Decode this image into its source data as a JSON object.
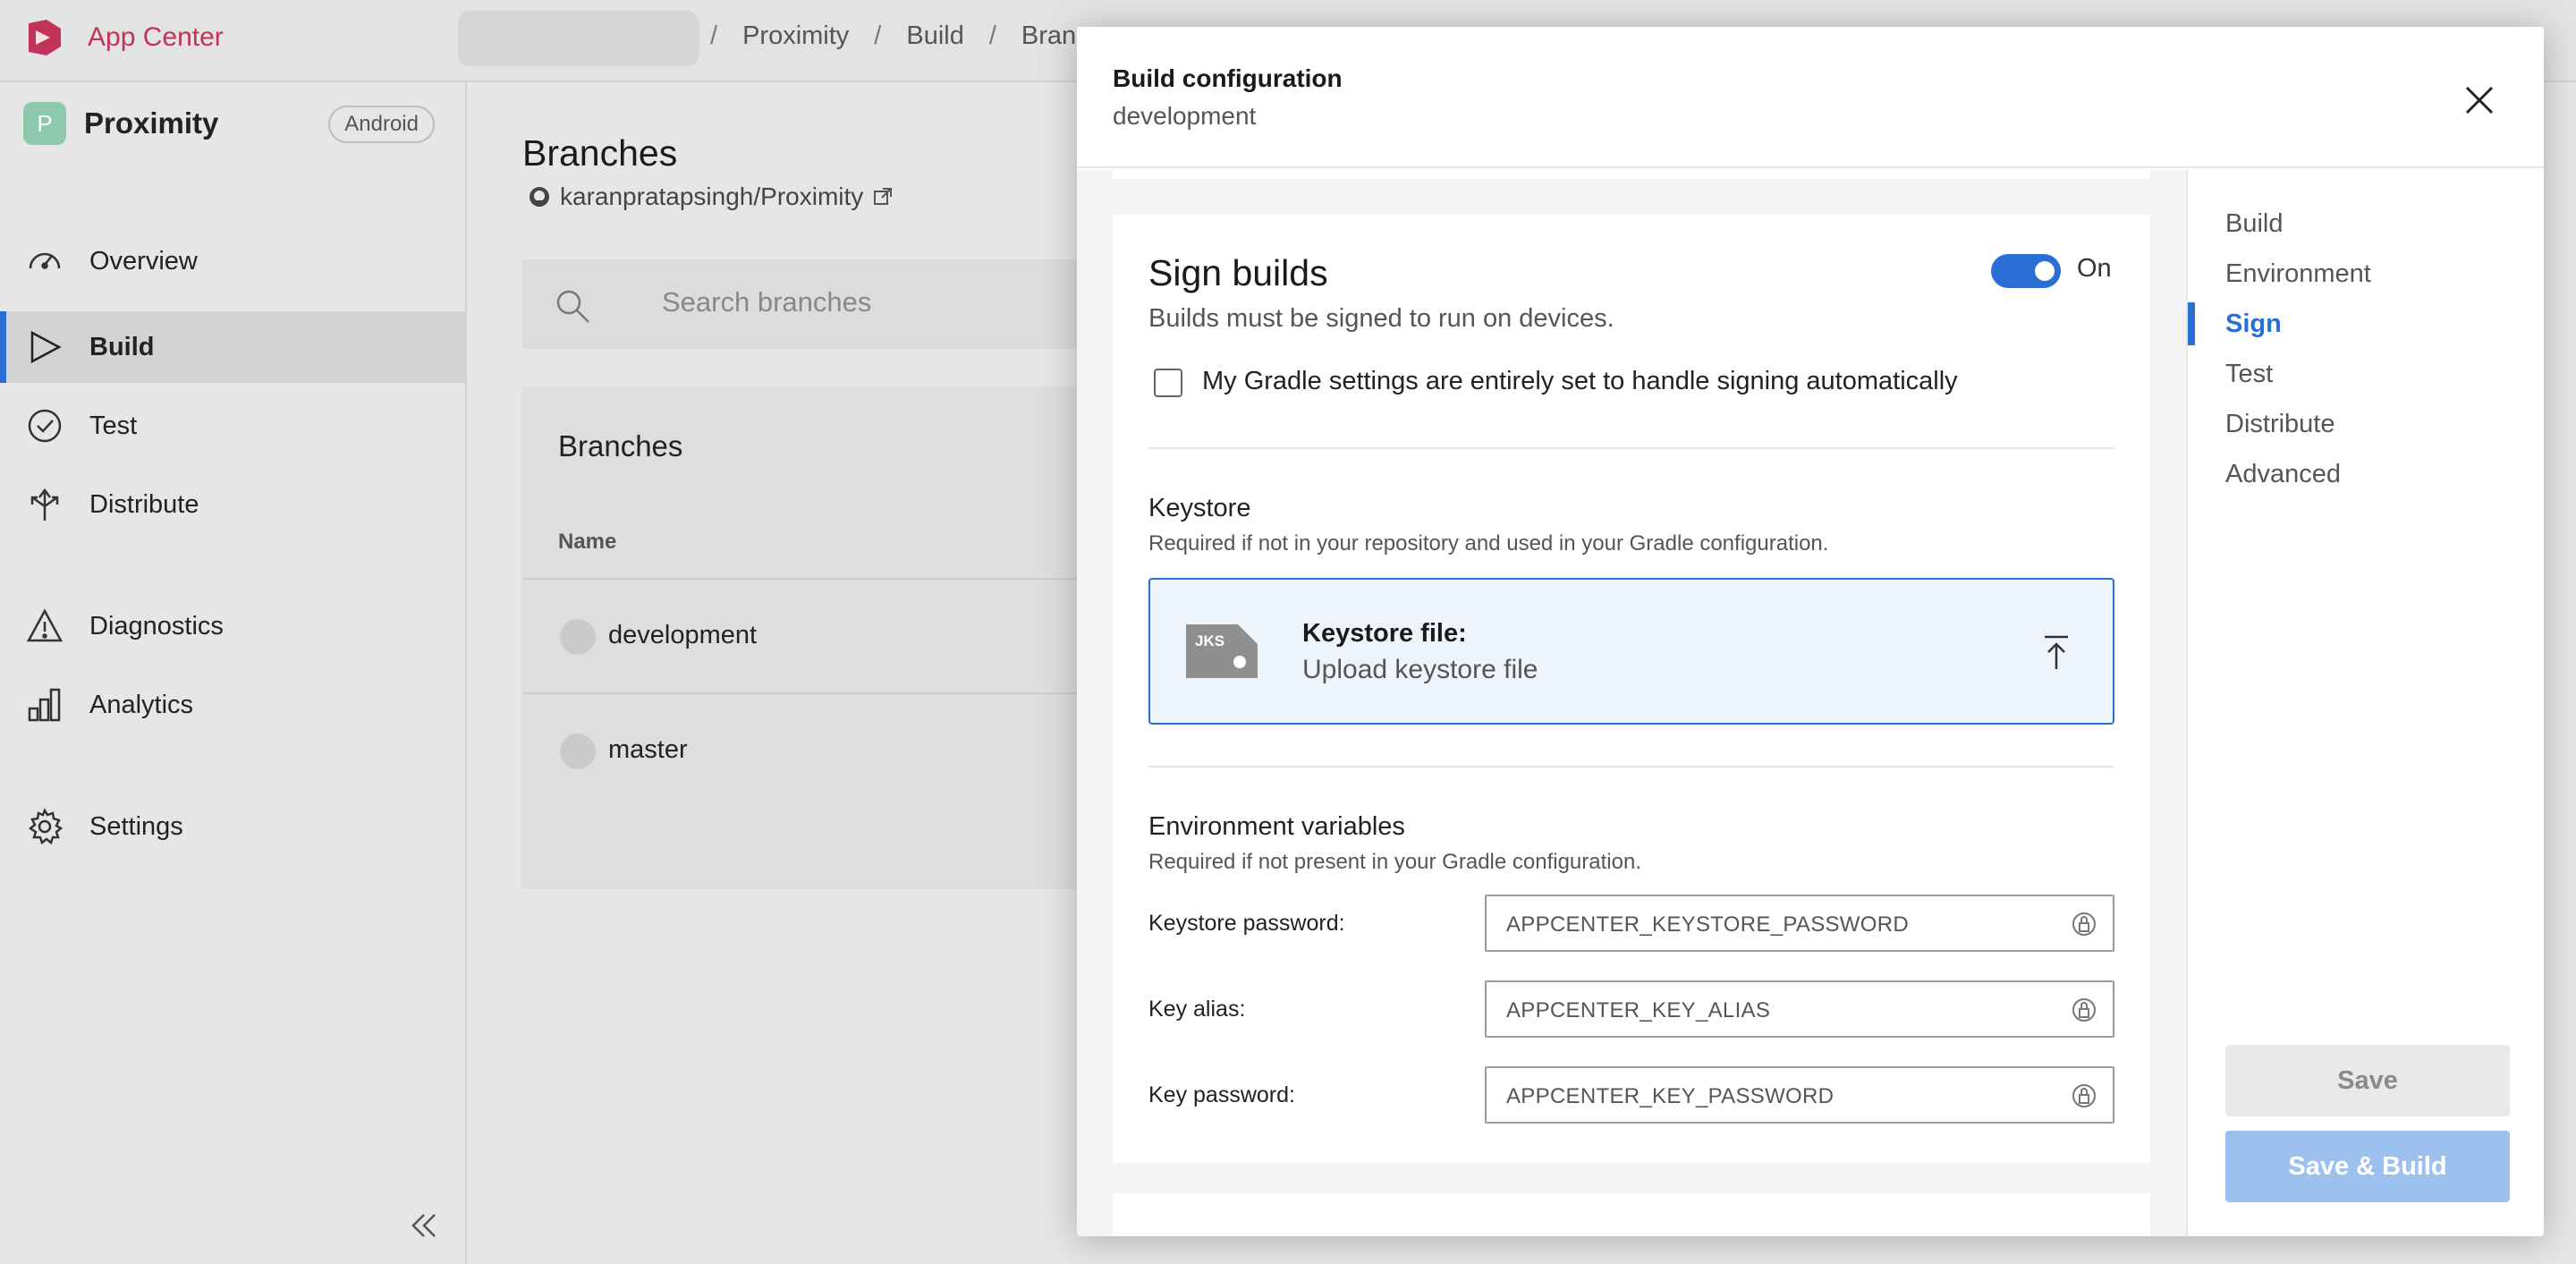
{
  "topbar": {
    "brand": "App Center",
    "breadcrumb": [
      "Proximity",
      "Build",
      "Bran"
    ]
  },
  "sidebar": {
    "app_initial": "P",
    "app_name": "Proximity",
    "os_badge": "Android",
    "items": [
      {
        "label": "Overview",
        "icon": "gauge-icon"
      },
      {
        "label": "Build",
        "icon": "play-icon",
        "active": true
      },
      {
        "label": "Test",
        "icon": "check-circle-icon"
      },
      {
        "label": "Distribute",
        "icon": "distribute-icon"
      },
      {
        "label": "Diagnostics",
        "icon": "warning-icon"
      },
      {
        "label": "Analytics",
        "icon": "bar-chart-icon"
      },
      {
        "label": "Settings",
        "icon": "gear-icon"
      }
    ]
  },
  "main": {
    "title": "Branches",
    "repo": "karanpratapsingh/Proximity",
    "search_placeholder": "Search branches",
    "card_title": "Branches",
    "column_name": "Name",
    "rows": [
      {
        "name": "development"
      },
      {
        "name": "master"
      }
    ]
  },
  "modal": {
    "title": "Build configuration",
    "subtitle": "development",
    "sign": {
      "title": "Sign builds",
      "description": "Builds must be signed to run on devices.",
      "toggle_label": "On",
      "toggle_on": true,
      "checkbox_label": "My Gradle settings are entirely set to handle signing automatically",
      "checkbox_checked": false,
      "keystore_title": "Keystore",
      "keystore_desc": "Required if not in your repository and used in your Gradle configuration.",
      "upload_badge": "JKS",
      "upload_title": "Keystore file:",
      "upload_sub": "Upload keystore file",
      "env_title": "Environment variables",
      "env_desc": "Required if not present in your Gradle configuration.",
      "fields": [
        {
          "label": "Keystore password:",
          "value": "APPCENTER_KEYSTORE_PASSWORD"
        },
        {
          "label": "Key alias:",
          "value": "APPCENTER_KEY_ALIAS"
        },
        {
          "label": "Key password:",
          "value": "APPCENTER_KEY_PASSWORD"
        }
      ]
    },
    "side_nav": [
      "Build",
      "Environment",
      "Sign",
      "Test",
      "Distribute",
      "Advanced"
    ],
    "side_active": "Sign",
    "save_label": "Save",
    "save_build_label": "Save & Build"
  },
  "colors": {
    "accent": "#2a6fd6",
    "brand": "#c0345a"
  }
}
